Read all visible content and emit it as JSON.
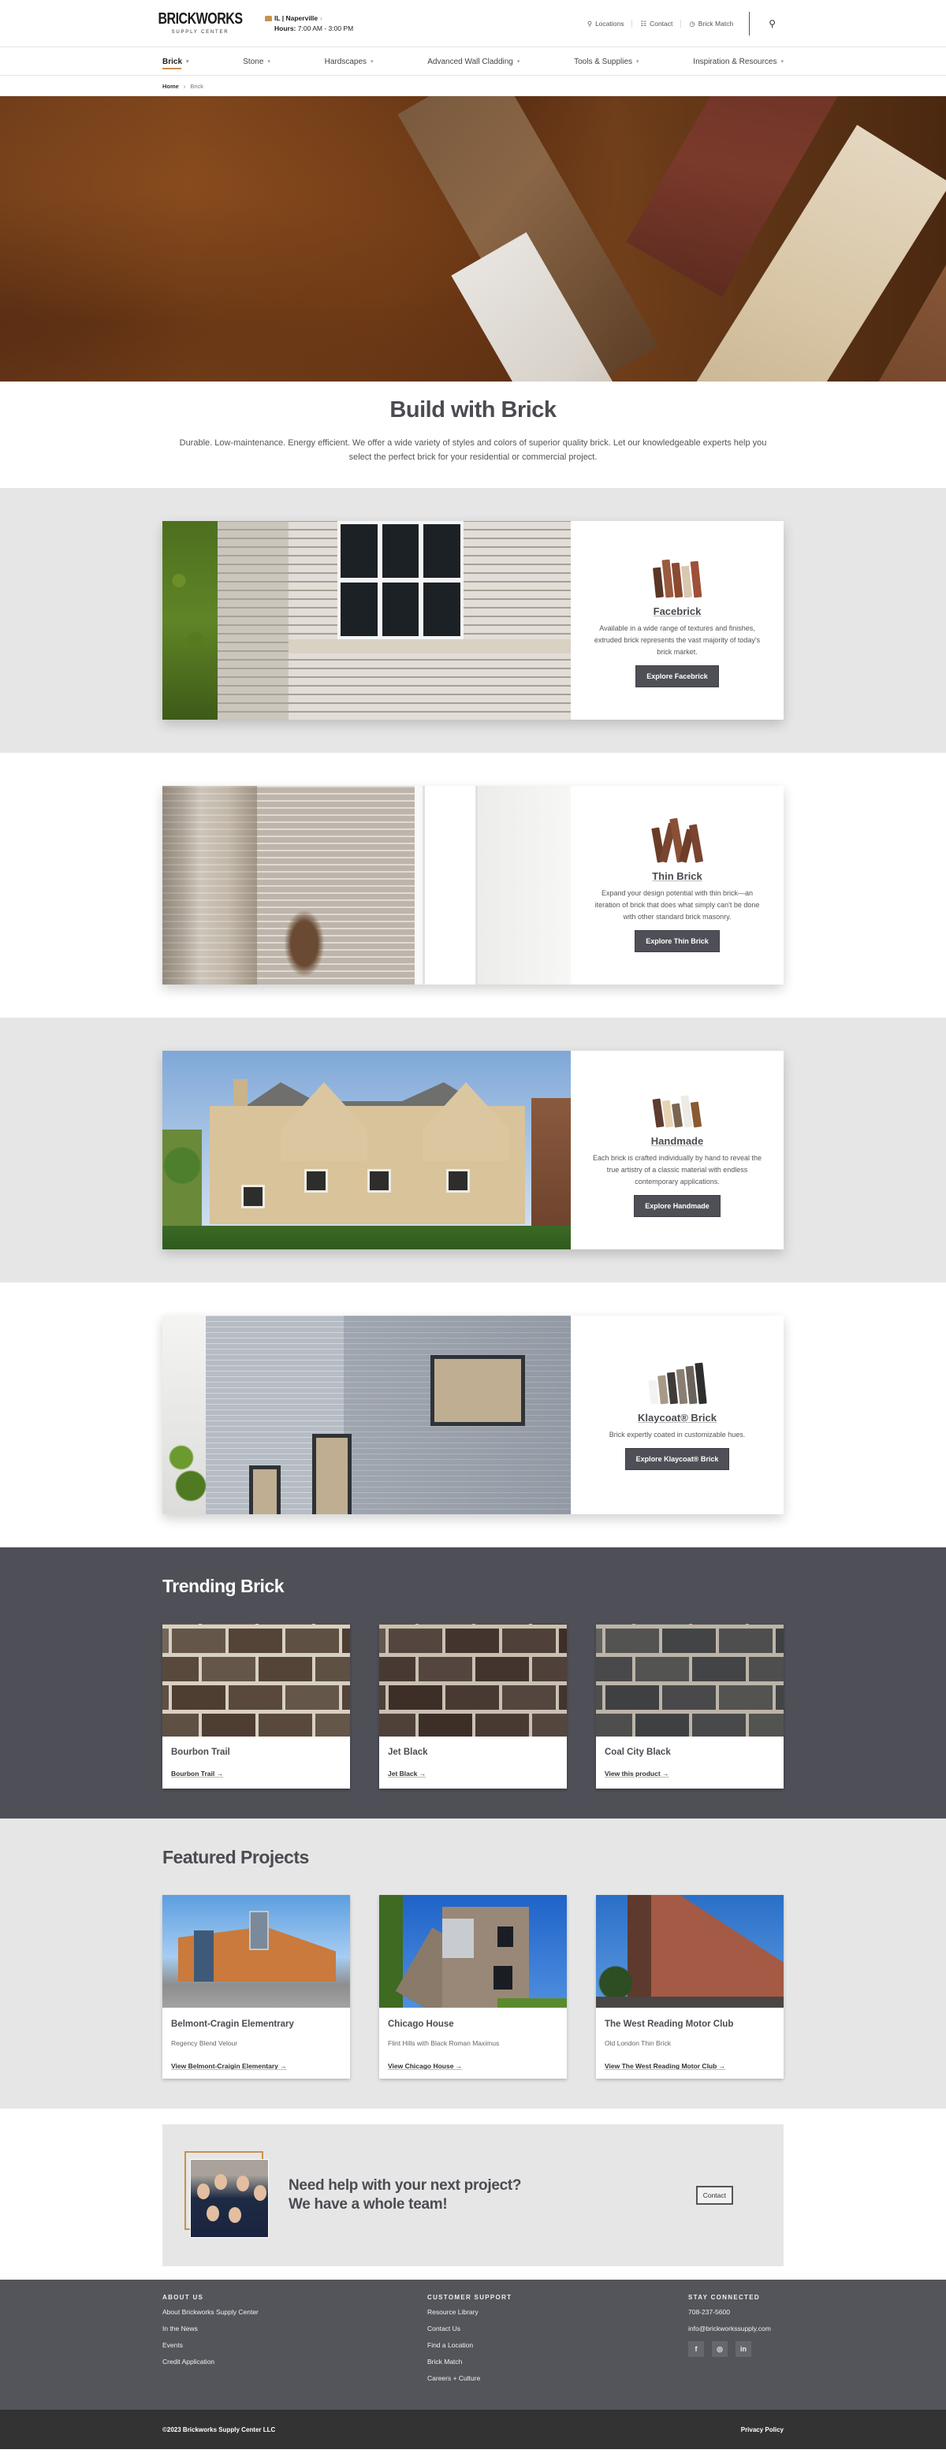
{
  "header": {
    "logo_main": "BRICKWORKS",
    "logo_sub": "SUPPLY CENTER",
    "store_location": "IL | Naperville",
    "store_chevron": "›",
    "hours_label": "Hours:",
    "hours_value": "7:00 AM - 3:00 PM",
    "utility_links": [
      {
        "icon": "map-pin-icon",
        "glyph": "⚲",
        "label": "Locations"
      },
      {
        "icon": "contact-icon",
        "glyph": "☷",
        "label": "Contact"
      },
      {
        "icon": "brick-match-icon",
        "glyph": "◷",
        "label": "Brick Match"
      }
    ],
    "search_glyph": "⚲"
  },
  "nav": {
    "items": [
      {
        "label": "Brick",
        "active": true
      },
      {
        "label": "Stone"
      },
      {
        "label": "Hardscapes"
      },
      {
        "label": "Advanced Wall Cladding"
      },
      {
        "label": "Tools & Supplies"
      },
      {
        "label": "Inspiration & Resources"
      }
    ],
    "caret": "▾"
  },
  "breadcrumb": {
    "items": [
      "Home",
      "Brick"
    ],
    "separator": "›"
  },
  "intro": {
    "title": "Build with Brick",
    "description": "Durable. Low-maintenance. Energy efficient. We offer a wide variety of styles and colors of superior quality brick. Let our knowledgeable experts help you select the perfect brick for your residential or commercial project."
  },
  "categories": [
    {
      "title": "Facebrick",
      "description": "Available in a wide range of textures and finishes, extruded brick represents the vast majority of today's brick market.",
      "button": "Explore Facebrick",
      "swatch_colors": [
        "#5a3626",
        "#9a5a3e",
        "#8a4a30",
        "#d8c8b0",
        "#9e5038"
      ]
    },
    {
      "title": "Thin Brick",
      "description": "Expand your design potential with thin brick—an iteration of brick that does what simply can't be done with other standard brick masonry.",
      "button": "Explore Thin Brick",
      "swatch_colors": [
        "#6a3c26",
        "#7a4530",
        "#8a5036",
        "#6e3e28",
        "#7a4430"
      ]
    },
    {
      "title": "Handmade",
      "description": "Each brick is crafted individually by hand to reveal the true artistry of a classic material with endless contemporary applications.",
      "button": "Explore Handmade",
      "swatch_colors": [
        "#5e3c30",
        "#e8d2b4",
        "#7a6650",
        "#ecebe6",
        "#8a5a30"
      ]
    },
    {
      "title": "Klaycoat® Brick",
      "description": "Brick expertly coated in customizable hues.",
      "button": "Explore Klaycoat® Brick",
      "swatch_colors": [
        "#f2f2f0",
        "#a89a88",
        "#3e3b38",
        "#8a7e72",
        "#6a635c",
        "#2e2e2e"
      ]
    }
  ],
  "trending": {
    "title": "Trending Brick",
    "items": [
      {
        "name": "Bourbon Trail",
        "link": "Bourbon Trail →",
        "brick": "#4a3a2e",
        "mortar": "#d8d0c2"
      },
      {
        "name": "Jet Black",
        "link": "Jet Black →",
        "brick": "#3a2b25",
        "mortar": "#c9c0b2"
      },
      {
        "name": "Coal City Black",
        "link": "View this product →",
        "brick": "#3c3d40",
        "mortar": "#bcb4a8"
      }
    ]
  },
  "featured": {
    "title": "Featured Projects",
    "items": [
      {
        "name": "Belmont-Cragin Elementrary",
        "material": "Regency Blend Velour",
        "link": "View Belmont-Craigin Elementary →"
      },
      {
        "name": "Chicago House",
        "material": "Flint Hills with Black Roman Maximus",
        "link": "View Chicago House →"
      },
      {
        "name": "The West Reading Motor Club",
        "material": "Old London Thin Brick",
        "link": "View The West Reading Motor Club →"
      }
    ]
  },
  "cta": {
    "line1": "Need help with your next project?",
    "line2": "We have a whole team!",
    "button": "Contact"
  },
  "footer": {
    "about": {
      "heading": "ABOUT US",
      "links": [
        "About Brickworks Supply Center",
        "In the News",
        "Events",
        "Credit Application"
      ]
    },
    "support": {
      "heading": "CUSTOMER SUPPORT",
      "links": [
        "Resource Library",
        "Contact Us",
        "Find a Location",
        "Brick Match",
        "Careers + Culture"
      ]
    },
    "connect": {
      "heading": "STAY CONNECTED",
      "phone": "708-237-5600",
      "email": "info@brickworkssupply.com",
      "social": [
        {
          "name": "facebook-icon",
          "glyph": "f"
        },
        {
          "name": "instagram-icon",
          "glyph": "◎"
        },
        {
          "name": "linkedin-icon",
          "glyph": "in"
        }
      ]
    },
    "copyright": "©2023 Brickworks Supply Center LLC",
    "privacy": "Privacy Policy"
  },
  "colors": {
    "accent": "#c8914e",
    "dark": "#4f5057",
    "text": "#4b4c52",
    "section_gray": "#e6e6e6"
  }
}
